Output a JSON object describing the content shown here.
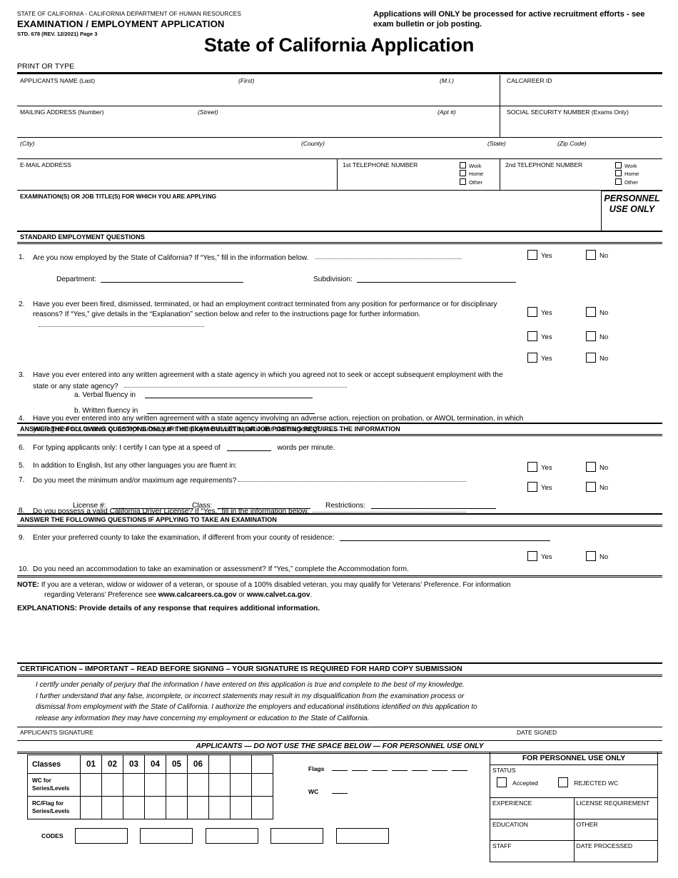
{
  "header": {
    "agency_line": "STATE OF CALIFORNIA - CALIFORNIA DEPARTMENT OF HUMAN RESOURCES",
    "form_title": "EXAMINATION / EMPLOYMENT APPLICATION",
    "form_code": "STD. 678 (REV. 12/2021) Page 3",
    "notice": "Applications will ONLY be processed for active recruitment efforts - see exam bulletin or job posting.",
    "main_title": "State of California Application",
    "print_or_type": "PRINT OR TYPE"
  },
  "identity": {
    "name_last": "APPLICANTS NAME (Last)",
    "name_first": "(First)",
    "name_mi": "(M.I.)",
    "calcareer_id": "CALCAREER ID",
    "mailing_address": "MAILING ADDRESS (Number)",
    "street": "(Street)",
    "apt": "(Apt #)",
    "ssn": "SOCIAL SECURITY NUMBER (Exams Only)",
    "city": "(City)",
    "county": "(County)",
    "state": "(State)",
    "zip": "(Zip Code)"
  },
  "contact": {
    "email_label": "E-MAIL ADDRESS",
    "phone1_label": "1st TELEPHONE NUMBER",
    "phone2_label": "2nd TELEPHONE NUMBER",
    "phone_options": [
      "Work",
      "Home",
      "Other"
    ],
    "exam_titles_label": "EXAMINATION(S) OR JOB TITLE(S) FOR WHICH YOU ARE APPLYING",
    "personnel_use_only": "PERSONNEL USE ONLY"
  },
  "sections": {
    "standard": "STANDARD EMPLOYMENT QUESTIONS",
    "exam_bulletin": "ANSWER THE FOLLOWING QUESTIONS ONLY IF THE EXAM BULLETIN OR JOB POSTING REQUIRES THE INFORMATION",
    "examination": "ANSWER THE FOLLOWING QUESTIONS IF APPLYING TO TAKE AN EXAMINATION",
    "certification": "CERTIFICATION – IMPORTANT – READ BEFORE SIGNING – YOUR SIGNATURE IS REQUIRED FOR HARD COPY SUBMISSION"
  },
  "yes_label": "Yes",
  "no_label": "No",
  "questions": {
    "q1_num": "1.",
    "q1_text": "Are you now employed by the State of California? If “Yes,” fill in the information below.",
    "q1_department": "Department:",
    "q1_subdivision": "Subdivision:",
    "q2_num": "2.",
    "q2_text": "Have you ever been fired, dismissed, terminated, or had an employment contract terminated from any position for performance or for disciplinary reasons? If “Yes,” give details in the “Explanation” section below and refer to the instructions page for further information.",
    "q3_num": "3.",
    "q3_text": "Have you ever entered into any written agreement with a state agency in which you agreed not to seek or accept subsequent employment with the state or any state agency?",
    "q4_num": "4.",
    "q4_text": "Have you ever entered into any written agreement with a state agency involving an adverse action, rejection on probation, or AWOL termination, in which you agreed not to seek or accept subsequent employment with a particular state agency?",
    "q5_num": "5.",
    "q5_text": "In addition to English, list any other languages you are fluent in:",
    "q5a": "a. Verbal fluency in",
    "q5b": "b. Written fluency in",
    "q6_num": "6.",
    "q6_text_a": "For typing applicants only: I certify I can type at a speed of",
    "q6_text_b": "words per minute.",
    "q7_num": "7.",
    "q7_text": "Do you meet the minimum and/or maximum age requirements?",
    "q8_num": "8.",
    "q8_text": "Do you possess a valid California Driver License? If “Yes,” fill in the information below.",
    "q8_license": "License #:",
    "q8_class": "Class:",
    "q8_restrictions": "Restrictions:",
    "q9_num": "9.",
    "q9_text": "Enter your preferred county to take the examination, if different from your county of residence:",
    "q10_num": "10.",
    "q10_text": "Do you need an accommodation to take an examination or assessment? If “Yes,” complete the Accommodation form."
  },
  "note": {
    "label": "NOTE:",
    "line1": "If you are a veteran, widow or widower of a veteran, or spouse of a 100% disabled veteran, you may qualify for Veterans’ Preference. For information",
    "line2_pre": "regarding Veterans’ Preference see ",
    "link1": "www.calcareers.ca.gov",
    "line2_mid": " or ",
    "link2": "www.calvet.ca.gov",
    "line2_post": ".",
    "explanations": "EXPLANATIONS: Provide details of any response that requires additional information."
  },
  "certification": {
    "line1": "I certify under penalty of perjury that the information I have entered on this application is true and complete to the best of my knowledge.",
    "line2": "I further understand that any false, incomplete, or incorrect statements may result in my disqualification from the examination process or",
    "line3": "dismissal from employment with the State of California. I authorize the employers and educational institutions identified on this application to",
    "line4": "release any information they may have concerning my employment or education to the State of California.",
    "signature_label": "APPLICANTS SIGNATURE",
    "date_label": "DATE SIGNED"
  },
  "personnel": {
    "banner": "APPLICANTS — DO NOT USE THE SPACE BELOW — FOR PERSONNEL USE ONLY",
    "classes_label": "Classes",
    "class_numbers": [
      "01",
      "02",
      "03",
      "04",
      "05",
      "06",
      "",
      "",
      ""
    ],
    "row_wc": "WC for Series/Levels",
    "row_rc": "RC/Flag for Series/Levels",
    "flags_label": "Flags",
    "flags_count": 7,
    "wc_label": "WC",
    "codes_label": "CODES",
    "codes_count": 5,
    "box_title": "FOR PERSONNEL USE ONLY",
    "status_label": "STATUS",
    "accepted_label": "Accepted",
    "rejected_label": "REJECTED WC",
    "experience_label": "EXPERIENCE",
    "license_req_label": "LICENSE REQUIREMENT",
    "education_label": "EDUCATION",
    "other_label": "OTHER",
    "staff_label": "STAFF",
    "date_processed_label": "DATE PROCESSED"
  }
}
